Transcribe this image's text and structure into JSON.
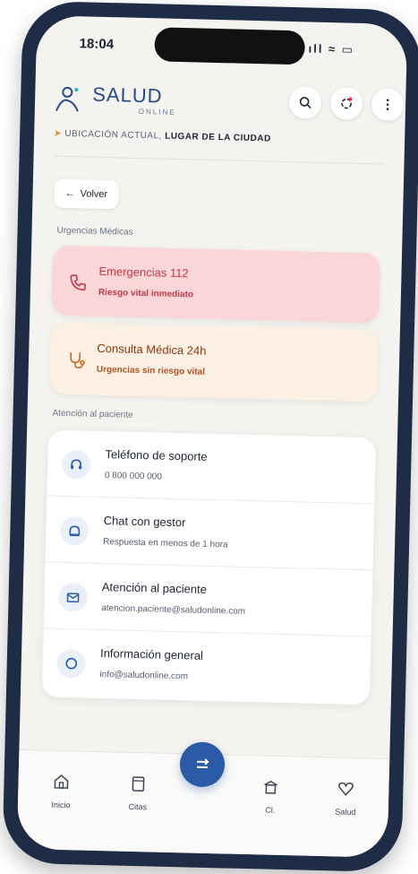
{
  "status": {
    "time": "18:04",
    "signal_icons": "ıll ≈ ▭"
  },
  "header": {
    "logo_text": "SALUD",
    "logo_sub": "ONLINE",
    "location_prefix": "UBICACIÓN ACTUAL",
    "location_value": "LUGAR DE LA CIUDAD"
  },
  "back": {
    "label": "Volver"
  },
  "emergencias": {
    "section_label": "Urgencias Médicas",
    "cards": [
      {
        "title": "Emergencias 112",
        "subtitle": "Riesgo vital inmediato",
        "icon": "phone-icon",
        "color": "#c03a4a"
      },
      {
        "title": "Consulta Médica 24h",
        "subtitle": "Urgencias sin riesgo vital",
        "icon": "stethoscope-icon",
        "color": "#b5521e"
      }
    ]
  },
  "atencion": {
    "section_label": "Atención al paciente",
    "items": [
      {
        "title": "Teléfono de soporte",
        "subtitle": "0 800 000 000",
        "icon": "headset-icon"
      },
      {
        "title": "Chat con gestor",
        "subtitle": "Respuesta en menos de 1 hora",
        "icon": "chat-icon"
      },
      {
        "title": "Atención al paciente",
        "subtitle": "atencion.paciente@saludonline.com",
        "icon": "mail-icon"
      },
      {
        "title": "Información general",
        "subtitle": "info@saludonline.com",
        "icon": "info-icon"
      }
    ]
  },
  "nav": {
    "items": [
      {
        "label": "Inicio",
        "icon": "home-icon"
      },
      {
        "label": "Citas",
        "icon": "calendar-icon"
      },
      {
        "label": "",
        "icon": "transfer-icon"
      },
      {
        "label": "Cl.",
        "icon": "clinic-icon"
      },
      {
        "label": "Salud",
        "icon": "heart-icon"
      }
    ]
  },
  "colors": {
    "accent": "#2b5aa6",
    "emergency_bg": "#fbd6d9",
    "consult_bg": "#fcefe3"
  }
}
